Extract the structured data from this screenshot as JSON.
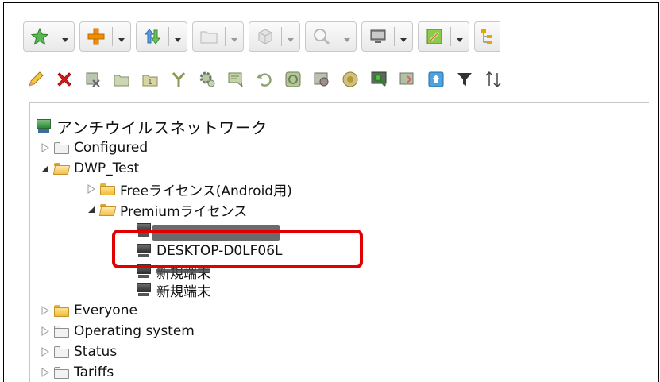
{
  "toolbar_top": {
    "buttons": [
      {
        "icon": "star-icon",
        "color": "#4aa84a",
        "disabled": false
      },
      {
        "icon": "plus-icon",
        "color": "#f08a00",
        "disabled": false
      },
      {
        "icon": "import-export-icon",
        "color": "#3f8fd8",
        "disabled": false
      },
      {
        "icon": "folder-icon",
        "color": "#d8d8d8",
        "disabled": true
      },
      {
        "icon": "cube-icon",
        "color": "#cfcfcf",
        "disabled": true
      },
      {
        "icon": "search-icon",
        "color": "#cfcfcf",
        "disabled": true
      },
      {
        "icon": "monitor-icon",
        "color": "#7a7a7a",
        "disabled": false
      },
      {
        "icon": "edit-doc-icon",
        "color": "#7dbd3d",
        "disabled": false
      },
      {
        "icon": "tree-layout-icon",
        "color": "#c99300",
        "disabled": false
      }
    ]
  },
  "toolbar_second": {
    "icons": [
      "pencil-icon",
      "delete-icon",
      "remove-filter-icon",
      "group-icon",
      "group-one-icon",
      "merge-icon",
      "settings-icon",
      "message-icon",
      "restore-icon",
      "update-icon",
      "virus-icon",
      "shield-icon",
      "scan-icon",
      "history-icon",
      "upload-icon",
      "filter-icon",
      "sort-icon"
    ]
  },
  "tree": {
    "root": {
      "label": "アンチウイルスネットワーク"
    },
    "configured": {
      "label": "Configured"
    },
    "dwp_test": {
      "label": "DWP_Test"
    },
    "free_license": {
      "label": "Freeライセンス(Android用)"
    },
    "premium_license": {
      "label": "Premiumライセンス"
    },
    "desktop": {
      "label": "DESKTOP-D0LF06L"
    },
    "new_terminal_1": {
      "label": "新規端末"
    },
    "new_terminal_2": {
      "label": "新規端末"
    },
    "everyone": {
      "label": "Everyone"
    },
    "operating_system": {
      "label": "Operating system"
    },
    "status": {
      "label": "Status"
    },
    "tariffs": {
      "label": "Tariffs"
    }
  },
  "colors": {
    "highlight": "#e10000"
  }
}
